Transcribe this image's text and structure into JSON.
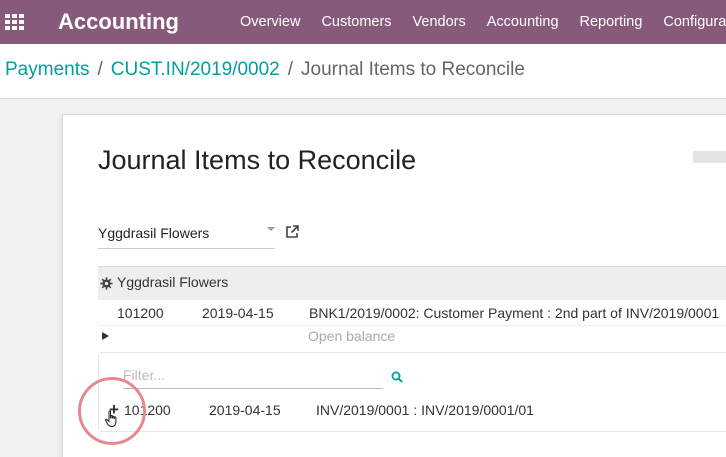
{
  "topbar": {
    "app_title": "Accounting",
    "menu": [
      "Overview",
      "Customers",
      "Vendors",
      "Accounting",
      "Reporting",
      "Configuration"
    ]
  },
  "breadcrumb": {
    "root": "Payments",
    "record": "CUST.IN/2019/0002",
    "current": "Journal Items to Reconcile"
  },
  "page": {
    "heading": "Journal Items to Reconcile"
  },
  "partner": {
    "selected": "Yggdrasil Flowers",
    "header_name": "Yggdrasil Flowers"
  },
  "move_line": {
    "account": "101200",
    "date": "2019-04-15",
    "label": "BNK1/2019/0002: Customer Payment : 2nd part of INV/2019/0001"
  },
  "open_balance": "Open balance",
  "filter": {
    "placeholder": "Filter..."
  },
  "candidate": {
    "account": "101200",
    "date": "2019-04-15",
    "label": "INV/2019/0001 : INV/2019/0001/01"
  },
  "colors": {
    "topbar": "#875a7b",
    "link": "#00a09d",
    "highlight_ring": "#e48a8e"
  }
}
